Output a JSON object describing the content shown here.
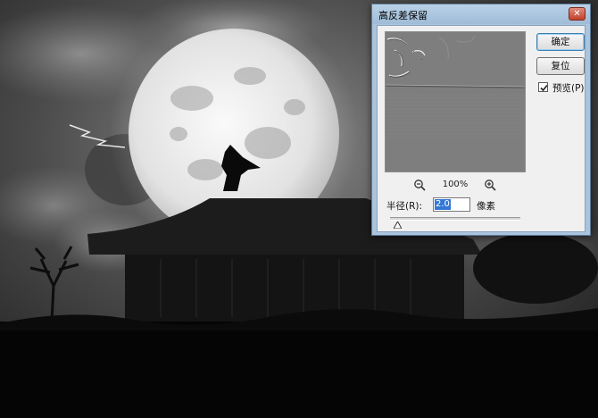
{
  "dialog": {
    "title": "高反差保留",
    "close_glyph": "✕",
    "ok_label": "确定",
    "reset_label": "复位",
    "preview_label": "预览(P)",
    "preview_checked": true,
    "zoom_value": "100%",
    "radius_label": "半径(R):",
    "radius_value": "2.0",
    "radius_unit": "像素",
    "radius_slider_fraction": 0.06
  },
  "colors": {
    "title_bar": "#a9c4dc",
    "client_bg": "#f0f0f0",
    "preview_bg": "#808080",
    "selection": "#3478d6"
  },
  "icons": [
    "zoom-out-icon",
    "zoom-in-icon",
    "close-icon",
    "slider-thumb-icon",
    "checkmark-icon"
  ]
}
